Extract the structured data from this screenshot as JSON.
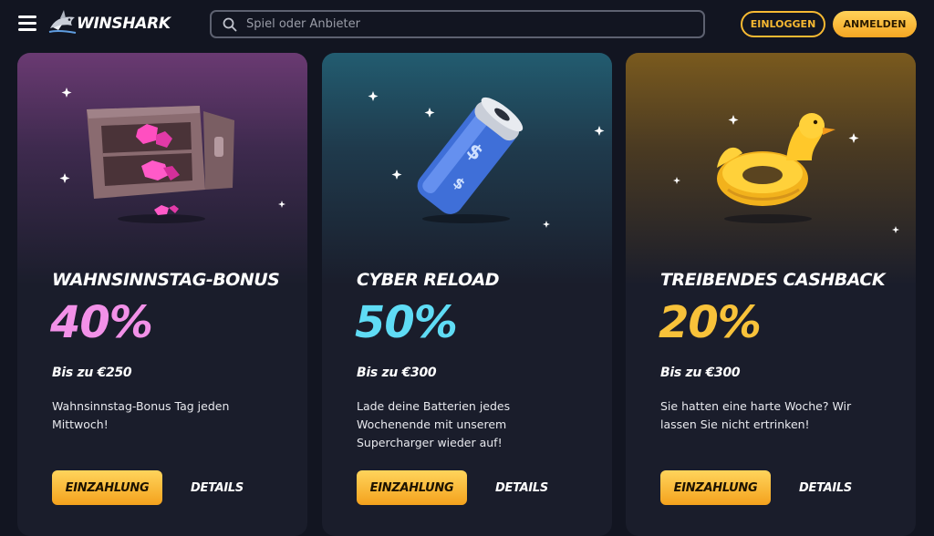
{
  "header": {
    "brand": "WINSHARK",
    "search_placeholder": "Spiel oder Anbieter",
    "login_label": "EINLOGGEN",
    "register_label": "ANMELDEN"
  },
  "cards": [
    {
      "title": "WAHNSINNSTAG-BONUS",
      "percent": "40%",
      "max": "Bis zu €250",
      "description": "Wahnsinnstag-Bonus Tag jeden Mittwoch!",
      "deposit_label": "EINZAHLUNG",
      "details_label": "DETAILS",
      "accent": "#f291e8",
      "icon": "safe-icon"
    },
    {
      "title": "CYBER RELOAD",
      "percent": "50%",
      "max": "Bis zu €300",
      "description": "Lade deine Batterien jedes Wochenende mit unserem Supercharger wieder auf!",
      "deposit_label": "EINZAHLUNG",
      "details_label": "DETAILS",
      "accent": "#5fdcf5",
      "icon": "battery-icon"
    },
    {
      "title": "TREIBENDES CASHBACK",
      "percent": "20%",
      "max": "Bis zu €300",
      "description": "Sie hatten eine harte Woche? Wir lassen Sie nicht ertrinken!",
      "deposit_label": "EINZAHLUNG",
      "details_label": "DETAILS",
      "accent": "#f8c23a",
      "icon": "duck-float-icon"
    }
  ]
}
